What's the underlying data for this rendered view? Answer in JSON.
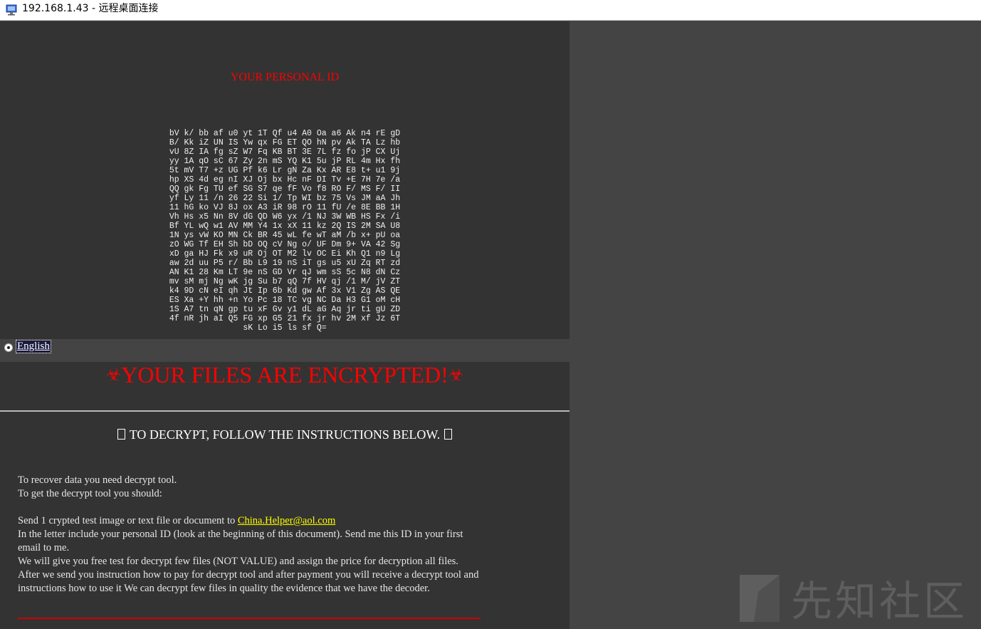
{
  "window": {
    "title": "192.168.1.43 - 远程桌面连接"
  },
  "id_section": {
    "title": "YOUR PERSONAL ID",
    "code_lines": [
      "bV k/ bb af u0 yt 1T Qf u4 A0 Oa a6 Ak n4 rE gD",
      "B/ Kk iZ UN IS Yw qx FG ET QO hN pv Ak TA Lz hb",
      "vU 8Z IA fg sZ W7 Fq KB BT 3E 7L fz fo jP CX Uj",
      "yy 1A qO sC 67 Zy 2n mS YQ K1 5u jP RL 4m Hx fh",
      "5t mV T7 +z UG Pf k6 Lr gN Za Kx AR E8 t+ u1 9j",
      "hp XS 4d eg nI XJ Oj bx Hc nF DI Tv +E 7H 7e /a",
      "QQ gk Fg TU ef SG S7 qe fF Vo f8 RO F/ MS F/ II",
      "yf Ly 11 /n 26 22 Si 1/ Tp WI bz 75 Vs JM aA Jh",
      "11 hG ko VJ 8J ox A3 iR 98 rO 11 fU /e 8E BB 1H",
      "Vh Hs x5 Nn 8V dG QD W6 yx /1 NJ 3W WB HS Fx /i",
      "Bf YL wQ w1 AV MM Y4 1x xX 11 kz 2Q IS 2M SA U8",
      "1N ys vW KO MN Ck BR 45 wL fe wT aM /b x+ pU oa",
      "zO WG Tf EH Sh bD OQ cV Ng o/ UF Dm 9+ VA 42 Sg",
      "xD ga HJ Fk x9 uR Oj OT M2 lv OC Ei Kh Q1 n9 Lg",
      "aw 2d uu P5 r/ Bb L9 19 nS iT gs u5 xU Zq RT zd",
      "AN K1 28 Km LT 9e nS GD Vr qJ wm sS 5c N8 dN Cz",
      "mv sM mj Ng wK jg Su b7 qQ 7f HV qj /1 M/ jV ZT",
      "k4 9D cN eI qh Jt Ip 6b Kd gw Af 3x V1 Zg AS QE",
      "ES Xa +Y hh +n Yo Pc 18 TC vg NC Da H3 G1 oM cH",
      "1S A7 tn qN gp tu xF Gv y1 dL aG Aq jr ti gU ZD",
      "4f nR jh aI Q5 FG xp G5 21 fx jr hv 2M xf Jz 6T",
      "sK Lo i5 ls sf Q="
    ]
  },
  "language": {
    "selected": "English"
  },
  "banner": {
    "title": "YOUR FILES ARE ENCRYPTED!"
  },
  "instructions": {
    "heading": "TO DECRYPT, FOLLOW THE INSTRUCTIONS BELOW.",
    "line1": "To recover data you need decrypt tool.",
    "line2": "To get the decrypt tool you should:",
    "send_prefix": "Send 1 crypted test image or text file or document to ",
    "email": "China.Helper@aol.com",
    "line4": "In the letter include your personal ID (look at the beginning of this document). Send me this ID in your first email to me.",
    "line5": "We will give you free test for decrypt few files (NOT VALUE) and assign the price for decryption all files.",
    "line6": "After we send you instruction how to pay for decrypt tool and after payment you will receive a decrypt tool and instructions how to use it We can decrypt few files in quality the evidence that we have the decoder."
  },
  "watermark": {
    "text": "先知社区"
  },
  "colors": {
    "accent_red": "#ff0000",
    "email_yellow": "#ffff00",
    "panel_bg": "#333333",
    "page_bg": "#444444"
  }
}
